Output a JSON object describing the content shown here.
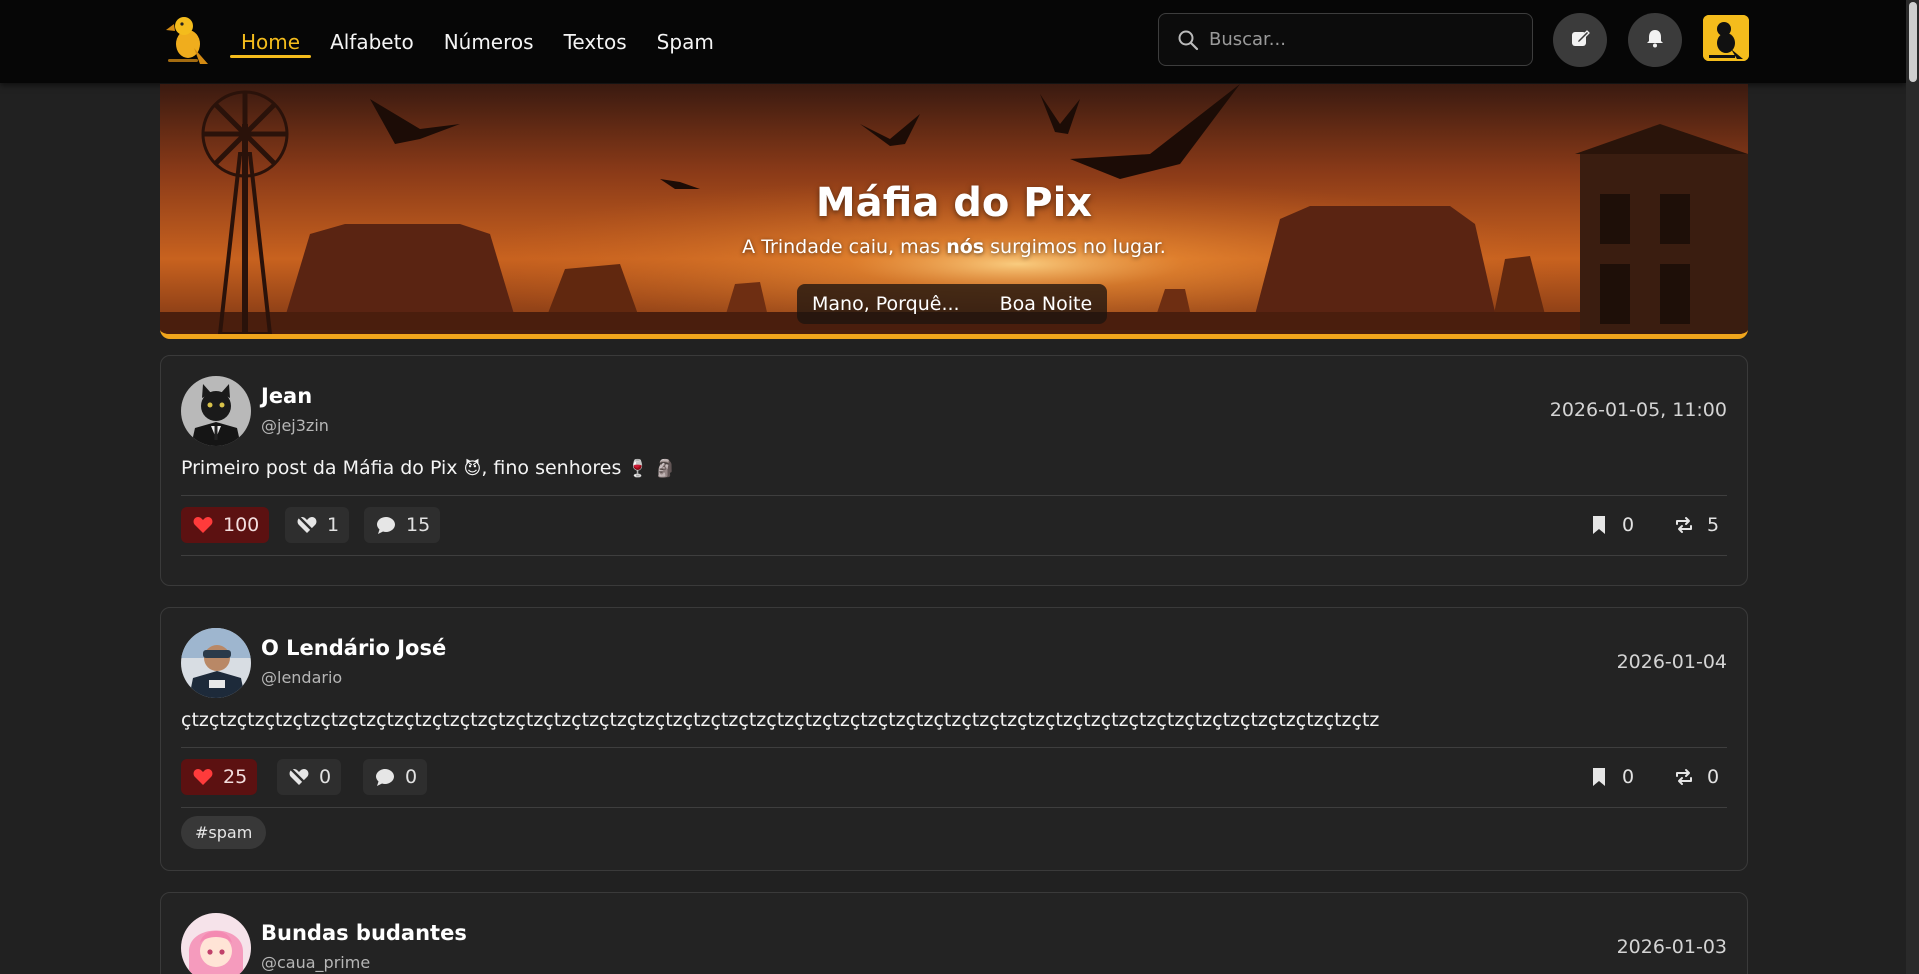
{
  "nav": {
    "links": [
      {
        "label": "Home",
        "active": true
      },
      {
        "label": "Alfabeto",
        "active": false
      },
      {
        "label": "Números",
        "active": false
      },
      {
        "label": "Textos",
        "active": false
      },
      {
        "label": "Spam",
        "active": false
      }
    ],
    "search_placeholder": "Buscar...",
    "accent_color": "#f4bc1c"
  },
  "banner": {
    "title": "Máfia do Pix",
    "subtitle_before": "A Trindade caiu, mas ",
    "subtitle_bold": "nós",
    "subtitle_after": " surgimos no lugar.",
    "pills": [
      "Mano, Porquê...",
      "Boa Noite"
    ]
  },
  "posts": [
    {
      "name": "Jean",
      "handle": "@jej3zin",
      "date": "2026-01-05, 11:00",
      "text": "Primeiro post da Máfia do Pix",
      "text_after_emoji": ", fino senhores",
      "likes": "100",
      "dislikes": "1",
      "comments": "15",
      "bookmarks": "0",
      "reposts": "5"
    },
    {
      "name": "O Lendário José",
      "handle": "@lendario",
      "date": "2026-01-04",
      "text": "çtzçtzçtzçtzçtzçtzçtzçtzçtzçtzçtzçtzçtzçtzçtzçtzçtzçtzçtzçtzçtzçtzçtzçtzçtzçtzçtzçtzçtzçtzçtzçtzçtzçtzçtzçtzçtzçtzçtzçtzçtzçtzçtz",
      "likes": "25",
      "dislikes": "0",
      "comments": "0",
      "bookmarks": "0",
      "reposts": "0",
      "tag": "#spam"
    },
    {
      "name": "Bundas budantes",
      "handle": "@caua_prime",
      "date": "2026-01-03"
    }
  ]
}
